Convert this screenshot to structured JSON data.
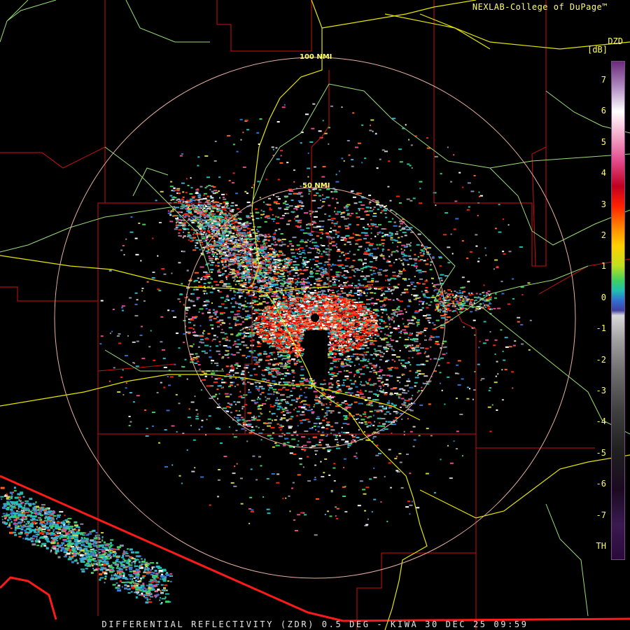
{
  "header": {
    "credit": "NEXLAB-College of DuPage™"
  },
  "scale": {
    "code": "DZD",
    "unit": "[dB]",
    "ticks": [
      "7",
      "6",
      "5",
      "4",
      "3",
      "2",
      "1",
      "0",
      "-1",
      "-2",
      "-3",
      "-4",
      "-5",
      "-6",
      "-7",
      "TH"
    ]
  },
  "rings": {
    "inner_label": "50 NMI",
    "outer_label": "100 NMI"
  },
  "footer": {
    "caption": "DIFFERENTIAL REFLECTIVITY (ZDR) 0.5 DEG - KIWA 30 DEC 25 09:59"
  },
  "colors": {
    "background": "#000000",
    "label": "#ffff66",
    "county_lines": "#cc1111",
    "border_line": "#ff1a1a",
    "highways_major": "#e6e600",
    "highways_minor": "#99dd77",
    "range_rings": "#e8b0a0"
  }
}
